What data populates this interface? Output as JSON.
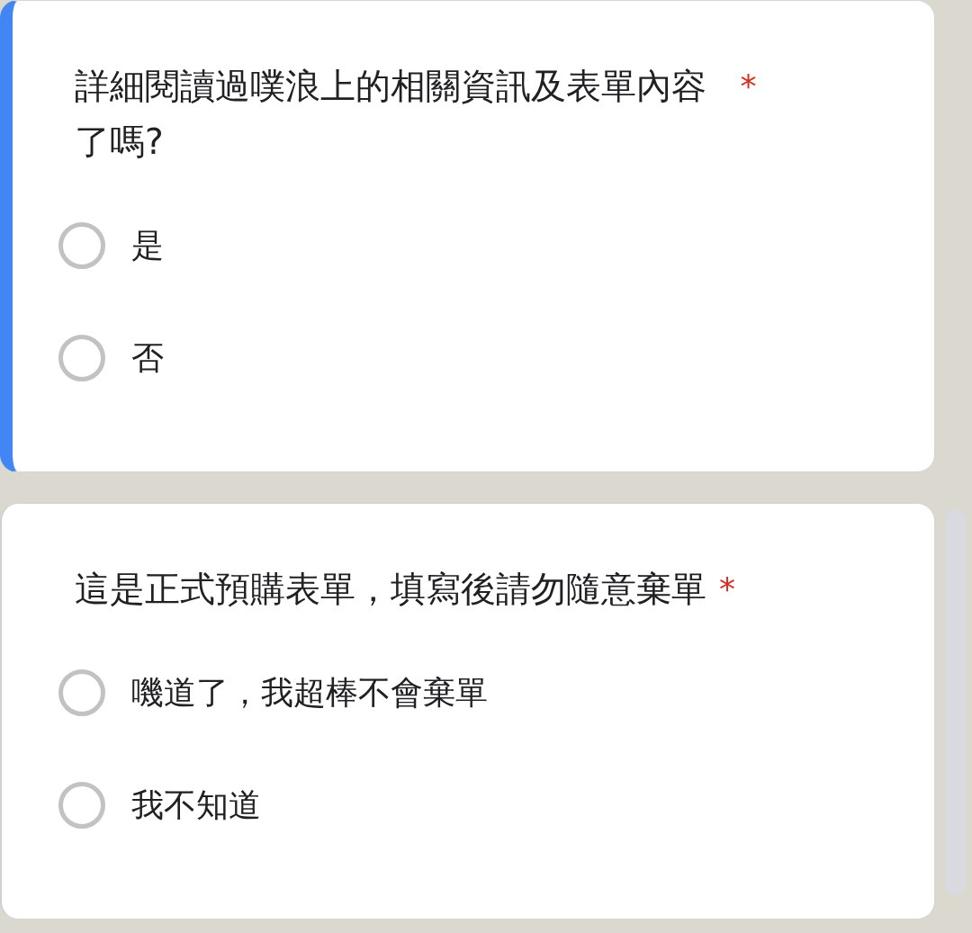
{
  "questions": [
    {
      "title": "詳細閱讀過噗浪上的相關資訊及表單內容了嗎?",
      "required_mark": "*",
      "focused": true,
      "options": [
        {
          "label": "是",
          "selected": false
        },
        {
          "label": "否",
          "selected": false
        }
      ]
    },
    {
      "title": "這是正式預購表單，填寫後請勿隨意棄單",
      "required_mark": "*",
      "focused": false,
      "options": [
        {
          "label": "嘰道了，我超棒不會棄單",
          "selected": false
        },
        {
          "label": "我不知道",
          "selected": false
        }
      ]
    }
  ]
}
